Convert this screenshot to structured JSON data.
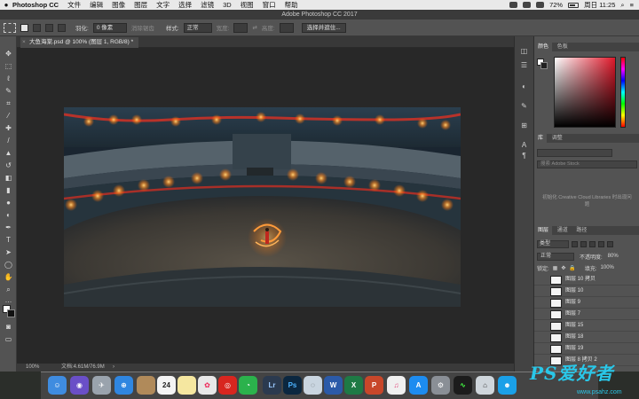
{
  "menubar": {
    "app_name": "Photoshop CC",
    "items": [
      "文件",
      "编辑",
      "图像",
      "图层",
      "文字",
      "选择",
      "滤镜",
      "3D",
      "视图",
      "窗口",
      "帮助"
    ],
    "battery": "72%",
    "datetime": "周日 11:25"
  },
  "window_title": "Adobe Photoshop CC 2017",
  "options": {
    "feather_label": "羽化:",
    "feather_value": "0 像素",
    "antialias": "消除锯齿",
    "style_label": "样式:",
    "style_value": "正常",
    "width_label": "宽度:",
    "height_label": "高度:",
    "select_mask_button": "选择并遮住..."
  },
  "document": {
    "tab_title": "大鱼海棠.psd @ 100% (图层 1, RGB/8) *",
    "zoom": "100%",
    "doc_info": "文档:4.61M/76.9M"
  },
  "panels": {
    "color_tabs": [
      "颜色",
      "色板"
    ],
    "library_tabs": [
      "库",
      "调整"
    ],
    "library_search_placeholder": "搜索 Adobe Stock",
    "library_message": "初始化 Creative Cloud Libraries 时出现问题",
    "layers_tabs": [
      "图层",
      "通道",
      "路径"
    ],
    "filter_kind": "类型",
    "blend_mode": "正常",
    "opacity_label": "不透明度:",
    "opacity_value": "80%",
    "lock_label": "锁定:",
    "fill_label": "填充:",
    "fill_value": "100%",
    "layers": [
      {
        "name": "图层 10 拷贝"
      },
      {
        "name": "图层 10"
      },
      {
        "name": "图层 9"
      },
      {
        "name": "图层 7"
      },
      {
        "name": "图层 15"
      },
      {
        "name": "图层 18"
      },
      {
        "name": "图层 19"
      },
      {
        "name": "图层 8 拷贝 2"
      }
    ]
  },
  "dock": {
    "calendar_day": "24",
    "apps": [
      "finder-icon",
      "siri-icon",
      "launchpad-icon",
      "safari-icon",
      "photos-folder-icon",
      "calendar-icon",
      "notes-icon",
      "photos-icon",
      "netease-music-icon",
      "wechat-icon",
      "lightroom-icon",
      "photoshop-icon",
      "bridge-icon",
      "word-icon",
      "excel-icon",
      "powerpoint-icon",
      "itunes-icon",
      "appstore-icon",
      "system-preferences-icon",
      "activity-icon",
      "trash-like-icon",
      "qq-icon"
    ]
  },
  "watermark": {
    "logo_text": "PS爱好者",
    "url": "www.psahz.com"
  },
  "colors": {
    "accent_blue": "#29c7e8",
    "panel_bg": "#535353",
    "canvas_bg": "#282828"
  }
}
